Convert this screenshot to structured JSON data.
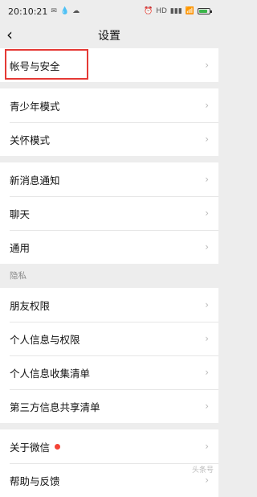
{
  "status_bar": {
    "time": "20:10:21",
    "left_icons": [
      "notification-icon",
      "water-drop-icon",
      "cloud-icon",
      "app-icon"
    ],
    "right_icons": [
      "alarm-icon",
      "hd-icon",
      "5g-signal-icon",
      "wifi-icon"
    ],
    "battery_color": "#3bb54a"
  },
  "nav": {
    "back_icon": "‹",
    "title": "设置"
  },
  "groups": {
    "g1": {
      "account_security": "帐号与安全"
    },
    "g2": {
      "youth_mode": "青少年模式",
      "care_mode": "关怀模式"
    },
    "g3": {
      "notifications": "新消息通知",
      "chat": "聊天",
      "general": "通用"
    },
    "privacy_header": "隐私",
    "g4": {
      "friend_permissions": "朋友权限",
      "personal_info_permissions": "个人信息与权限",
      "personal_info_collection": "个人信息收集清单",
      "third_party_sharing": "第三方信息共享清单"
    },
    "g5": {
      "about_wechat": "关于微信",
      "feedback": "帮助与反馈"
    }
  },
  "chevron": "›",
  "highlight_color": "#e53935",
  "dot_color": "#f44336",
  "watermark": "头条号"
}
